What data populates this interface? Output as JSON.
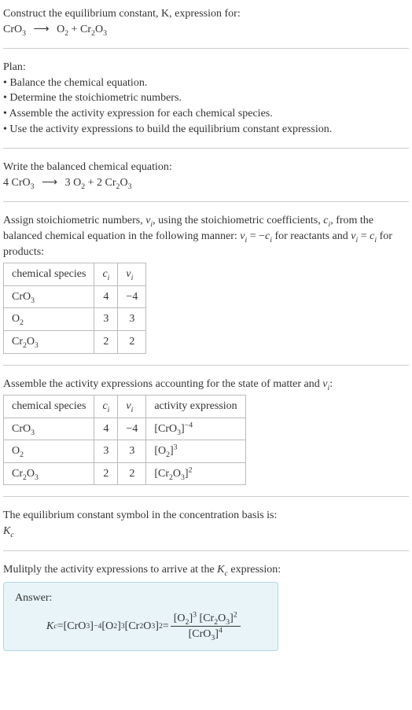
{
  "header": {
    "line1": "Construct the equilibrium constant, K, expression for:",
    "equation_reactant": "CrO",
    "equation_reactant_sub": "3",
    "arrow": "⟶",
    "equation_product1": "O",
    "equation_product1_sub": "2",
    "plus": " + ",
    "equation_product2": "Cr",
    "equation_product2_sub1": "2",
    "equation_product2_mid": "O",
    "equation_product2_sub2": "3"
  },
  "plan": {
    "title": "Plan:",
    "items": [
      "Balance the chemical equation.",
      "Determine the stoichiometric numbers.",
      "Assemble the activity expression for each chemical species.",
      "Use the activity expressions to build the equilibrium constant expression."
    ]
  },
  "balanced": {
    "intro": "Write the balanced chemical equation:",
    "c1": "4 ",
    "r1": "CrO",
    "r1_sub": "3",
    "arrow": "⟶",
    "c2": "3 ",
    "p1": "O",
    "p1_sub": "2",
    "plus": " + ",
    "c3": "2 ",
    "p2a": "Cr",
    "p2a_sub": "2",
    "p2b": "O",
    "p2b_sub": "3"
  },
  "assign": {
    "text1": "Assign stoichiometric numbers, ",
    "nu": "ν",
    "sub_i": "i",
    "text2": ", using the stoichiometric coefficients, ",
    "c": "c",
    "text3": ", from the balanced chemical equation in the following manner: ",
    "eq1": " = −",
    "text4": " for reactants and ",
    "eq2": " = ",
    "text5": " for products:"
  },
  "table1": {
    "headers": {
      "species": "chemical species",
      "ci": "c",
      "ci_sub": "i",
      "nui": "ν",
      "nui_sub": "i"
    },
    "rows": [
      {
        "species_a": "CrO",
        "species_sub": "3",
        "species_b": "",
        "species_sub2": "",
        "ci": "4",
        "nui": "−4"
      },
      {
        "species_a": "O",
        "species_sub": "2",
        "species_b": "",
        "species_sub2": "",
        "ci": "3",
        "nui": "3"
      },
      {
        "species_a": "Cr",
        "species_sub": "2",
        "species_b": "O",
        "species_sub2": "3",
        "ci": "2",
        "nui": "2"
      }
    ]
  },
  "assemble": {
    "text": "Assemble the activity expressions accounting for the state of matter and ",
    "nu": "ν",
    "sub_i": "i",
    "colon": ":"
  },
  "table2": {
    "headers": {
      "species": "chemical species",
      "ci": "c",
      "ci_sub": "i",
      "nui": "ν",
      "nui_sub": "i",
      "activity": "activity expression"
    },
    "rows": [
      {
        "species_a": "CrO",
        "species_sub": "3",
        "species_b": "",
        "species_sub2": "",
        "ci": "4",
        "nui": "−4",
        "act_a": "[CrO",
        "act_sub": "3",
        "act_b": "]",
        "act_sup": "−4"
      },
      {
        "species_a": "O",
        "species_sub": "2",
        "species_b": "",
        "species_sub2": "",
        "ci": "3",
        "nui": "3",
        "act_a": "[O",
        "act_sub": "2",
        "act_b": "]",
        "act_sup": "3"
      },
      {
        "species_a": "Cr",
        "species_sub": "2",
        "species_b": "O",
        "species_sub2": "3",
        "ci": "2",
        "nui": "2",
        "act_a": "[Cr",
        "act_sub": "2",
        "act_mid": "O",
        "act_sub2": "3",
        "act_b": "]",
        "act_sup": "2"
      }
    ]
  },
  "symbol": {
    "text": "The equilibrium constant symbol in the concentration basis is:",
    "K": "K",
    "K_sub": "c"
  },
  "multiply": {
    "text": "Mulitply the activity expressions to arrive at the ",
    "K": "K",
    "K_sub": "c",
    "text2": " expression:"
  },
  "answer": {
    "label": "Answer:",
    "K": "K",
    "K_sub": "c",
    "eq": " = ",
    "t1_a": "[CrO",
    "t1_sub": "3",
    "t1_b": "]",
    "t1_sup": "−4",
    "t2_a": " [O",
    "t2_sub": "2",
    "t2_b": "]",
    "t2_sup": "3",
    "t3_a": " [Cr",
    "t3_sub1": "2",
    "t3_mid": "O",
    "t3_sub2": "3",
    "t3_b": "]",
    "t3_sup": "2",
    "eq2": " = ",
    "num_a": "[O",
    "num_sub": "2",
    "num_b": "]",
    "num_sup": "3",
    "num2_a": " [Cr",
    "num2_sub1": "2",
    "num2_mid": "O",
    "num2_sub2": "3",
    "num2_b": "]",
    "num2_sup": "2",
    "den_a": "[CrO",
    "den_sub": "3",
    "den_b": "]",
    "den_sup": "4"
  }
}
